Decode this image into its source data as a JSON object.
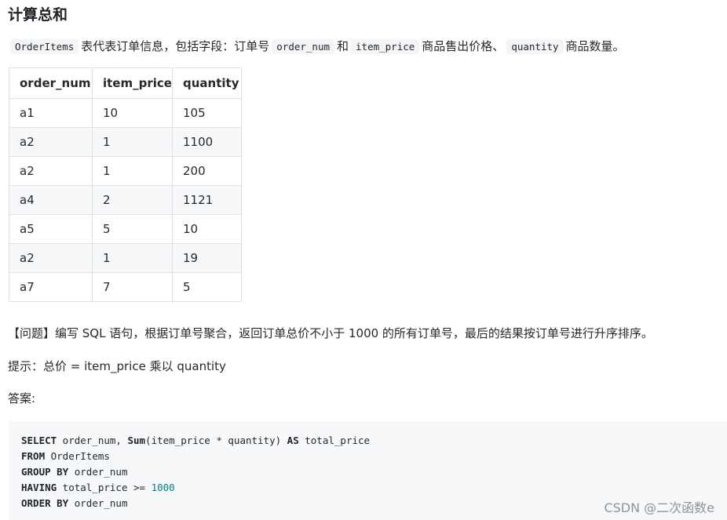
{
  "heading": "计算总和",
  "intro": {
    "code_table": "OrderItems",
    "text1": "表代表订单信息，包括字段：订单号",
    "code_order_num": "order_num",
    "text2": "和",
    "code_item_price": "item_price",
    "text3": "商品售出价格、",
    "code_quantity": "quantity",
    "text4": "商品数量。"
  },
  "table": {
    "headers": [
      "order_num",
      "item_price",
      "quantity"
    ],
    "rows": [
      [
        "a1",
        "10",
        "105"
      ],
      [
        "a2",
        "1",
        "1100"
      ],
      [
        "a2",
        "1",
        "200"
      ],
      [
        "a4",
        "2",
        "1121"
      ],
      [
        "a5",
        "5",
        "10"
      ],
      [
        "a2",
        "1",
        "19"
      ],
      [
        "a7",
        "7",
        "5"
      ]
    ]
  },
  "question": "【问题】编写 SQL 语句，根据订单号聚合，返回订单总价不小于 1000 的所有订单号，最后的结果按订单号进行升序排序。",
  "hint": "提示：总价 = item_price 乘以 quantity",
  "answer_label": "答案:",
  "code": {
    "line1": {
      "kw1": "SELECT",
      "t1": " order_num, ",
      "kw2": "Sum",
      "t2": "(item_price * quantity) ",
      "kw3": "AS",
      "t3": " total_price"
    },
    "line2": {
      "kw1": "FROM",
      "t1": " OrderItems"
    },
    "line3": {
      "kw1": "GROUP BY",
      "t1": " order_num"
    },
    "line4": {
      "kw1": "HAVING",
      "t1": " total_price >= ",
      "num": "1000"
    },
    "line5": {
      "kw1": "ORDER BY",
      "t1": " order_num"
    }
  },
  "watermark": "CSDN @二次函数e"
}
